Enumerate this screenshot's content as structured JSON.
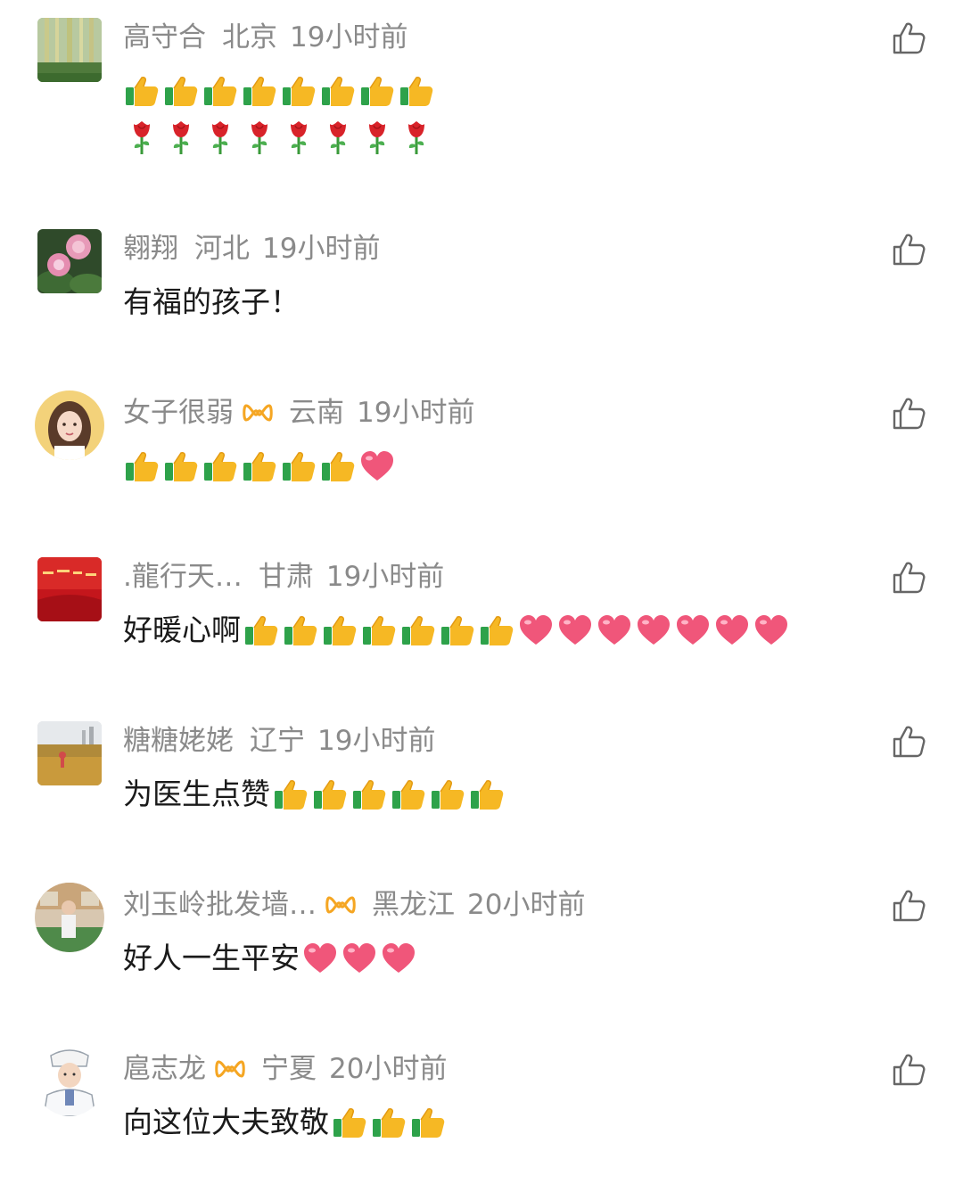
{
  "comments": [
    {
      "username": "高守合",
      "badge": false,
      "location": "北京",
      "time": "19小时前",
      "text": "",
      "lines": [
        [
          "thumbs-up-emoji",
          "thumbs-up-emoji",
          "thumbs-up-emoji",
          "thumbs-up-emoji",
          "thumbs-up-emoji",
          "thumbs-up-emoji",
          "thumbs-up-emoji",
          "thumbs-up-emoji"
        ],
        [
          "rose-emoji",
          "rose-emoji",
          "rose-emoji",
          "rose-emoji",
          "rose-emoji",
          "rose-emoji",
          "rose-emoji",
          "rose-emoji"
        ]
      ],
      "avatar": "bamboo-avatar"
    },
    {
      "username": "翱翔",
      "badge": false,
      "location": "河北",
      "time": "19小时前",
      "text": "有福的孩子！",
      "lines": [
        []
      ],
      "avatar": "flower-avatar"
    },
    {
      "username": "女子很弱",
      "badge": true,
      "location": "云南",
      "time": "19小时前",
      "text": "",
      "lines": [
        [
          "thumbs-up-emoji",
          "thumbs-up-emoji",
          "thumbs-up-emoji",
          "thumbs-up-emoji",
          "thumbs-up-emoji",
          "thumbs-up-emoji",
          "heart-emoji"
        ]
      ],
      "avatar": "woman-avatar"
    },
    {
      "username": ".龍行天…",
      "badge": false,
      "location": "甘肃",
      "time": "19小时前",
      "text": "好暖心啊",
      "lines": [
        [
          "thumbs-up-emoji",
          "thumbs-up-emoji",
          "thumbs-up-emoji",
          "thumbs-up-emoji",
          "thumbs-up-emoji",
          "thumbs-up-emoji",
          "thumbs-up-emoji",
          "heart-emoji",
          "heart-emoji",
          "heart-emoji",
          "heart-emoji",
          "heart-emoji",
          "heart-emoji",
          "heart-emoji"
        ]
      ],
      "avatar": "red-banner-avatar"
    },
    {
      "username": "糖糖姥姥",
      "badge": false,
      "location": "辽宁",
      "time": "19小时前",
      "text": "为医生点赞",
      "lines": [
        [
          "thumbs-up-emoji",
          "thumbs-up-emoji",
          "thumbs-up-emoji",
          "thumbs-up-emoji",
          "thumbs-up-emoji",
          "thumbs-up-emoji"
        ]
      ],
      "avatar": "field-avatar"
    },
    {
      "username": "刘玉岭批发墙…",
      "badge": true,
      "location": "黑龙江",
      "time": "20小时前",
      "text": "好人一生平安",
      "lines": [
        [
          "heart-emoji",
          "heart-emoji",
          "heart-emoji"
        ]
      ],
      "avatar": "shop-avatar"
    },
    {
      "username": "扈志龙",
      "badge": true,
      "location": "宁夏",
      "time": "20小时前",
      "text": "向这位大夫致敬",
      "lines": [
        [
          "thumbs-up-emoji",
          "thumbs-up-emoji",
          "thumbs-up-emoji"
        ]
      ],
      "avatar": "doctor-avatar"
    }
  ],
  "colors": {
    "meta": "#8a8a8a",
    "text": "#1a1a1a",
    "badge": "#f5a623",
    "like_icon": "#666666"
  }
}
